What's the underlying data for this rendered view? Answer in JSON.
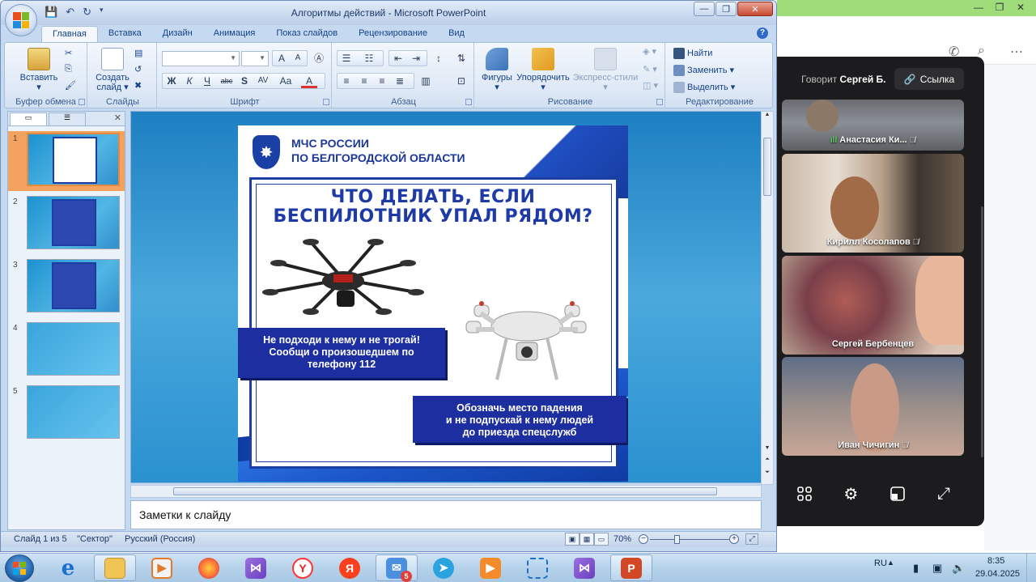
{
  "powerpoint": {
    "window_title": "Алгоритмы действий - Microsoft PowerPoint",
    "ribbon_tabs": [
      {
        "label": "Главная"
      },
      {
        "label": "Вставка"
      },
      {
        "label": "Дизайн"
      },
      {
        "label": "Анимация"
      },
      {
        "label": "Показ слайдов"
      },
      {
        "label": "Рецензирование"
      },
      {
        "label": "Вид"
      }
    ],
    "groups": {
      "clipboard": {
        "label": "Буфер обмена",
        "paste_label": "Вставить"
      },
      "slides": {
        "label": "Слайды",
        "new_slide_label_1": "Создать",
        "new_slide_label_2": "слайд"
      },
      "font": {
        "label": "Шрифт",
        "font_name": "",
        "font_size": "",
        "bold": "Ж",
        "italic": "К",
        "underline": "Ч",
        "strike": "abc",
        "shadow": "S",
        "spacing": "AV",
        "case": "Aa",
        "color": "A",
        "grow": "A",
        "shrink": "A"
      },
      "paragraph": {
        "label": "Абзац"
      },
      "drawing": {
        "label": "Рисование",
        "shapes_label": "Фигуры",
        "arrange_label": "Упорядочить",
        "styles_label": "Экспресс-стили"
      },
      "editing": {
        "label": "Редактирование",
        "find_label": "Найти",
        "replace_label": "Заменить",
        "select_label": "Выделить"
      }
    },
    "slide_thumbnails": [
      {
        "number": "1"
      },
      {
        "number": "2"
      },
      {
        "number": "3"
      },
      {
        "number": "4"
      },
      {
        "number": "5"
      }
    ],
    "slide": {
      "org_line1": "МЧС РОССИИ",
      "org_line2": "ПО БЕЛГОРОДСКОЙ ОБЛАСТИ",
      "headline_line1": "ЧТО ДЕЛАТЬ, ЕСЛИ",
      "headline_line2": "БЕСПИЛОТНИК УПАЛ РЯДОМ?",
      "box1_line1": "Не подходи к нему и не трогай!",
      "box1_line2": "Сообщи о произошедшем по",
      "box1_line3": "телефону 112",
      "box2_line1": "Обозначь место падения",
      "box2_line2": "и не подпускай к нему людей",
      "box2_line3": "до приезда спецслужб"
    },
    "notes_placeholder": "Заметки к слайду",
    "status": {
      "slide_of": "Слайд 1 из 5",
      "theme": "\"Сектор\"",
      "language": "Русский (Россия)",
      "zoom": "70%",
      "zoom_fraction": 0.35
    }
  },
  "call": {
    "speaker_prefix": "Говорит",
    "speaker_name": "Сергей Б.",
    "link_label": "Ссылка",
    "participants": [
      {
        "name": "Анастасия Ки..."
      },
      {
        "name": "Кирилл Косолапов"
      },
      {
        "name": "Сергей Бербенцев"
      },
      {
        "name": "Иван Чичигин"
      }
    ]
  },
  "taskbar": {
    "language": "RU",
    "time": "8:35",
    "date": "29.04.2025",
    "telegram_badge": "5"
  },
  "icons": {
    "office": "office-logo-icon",
    "start": "windows-start-icon"
  },
  "colors": {
    "ribbon_text": "#15428b",
    "slide_blue": "#1d3aa6",
    "call_bg": "#1c1c1e"
  }
}
